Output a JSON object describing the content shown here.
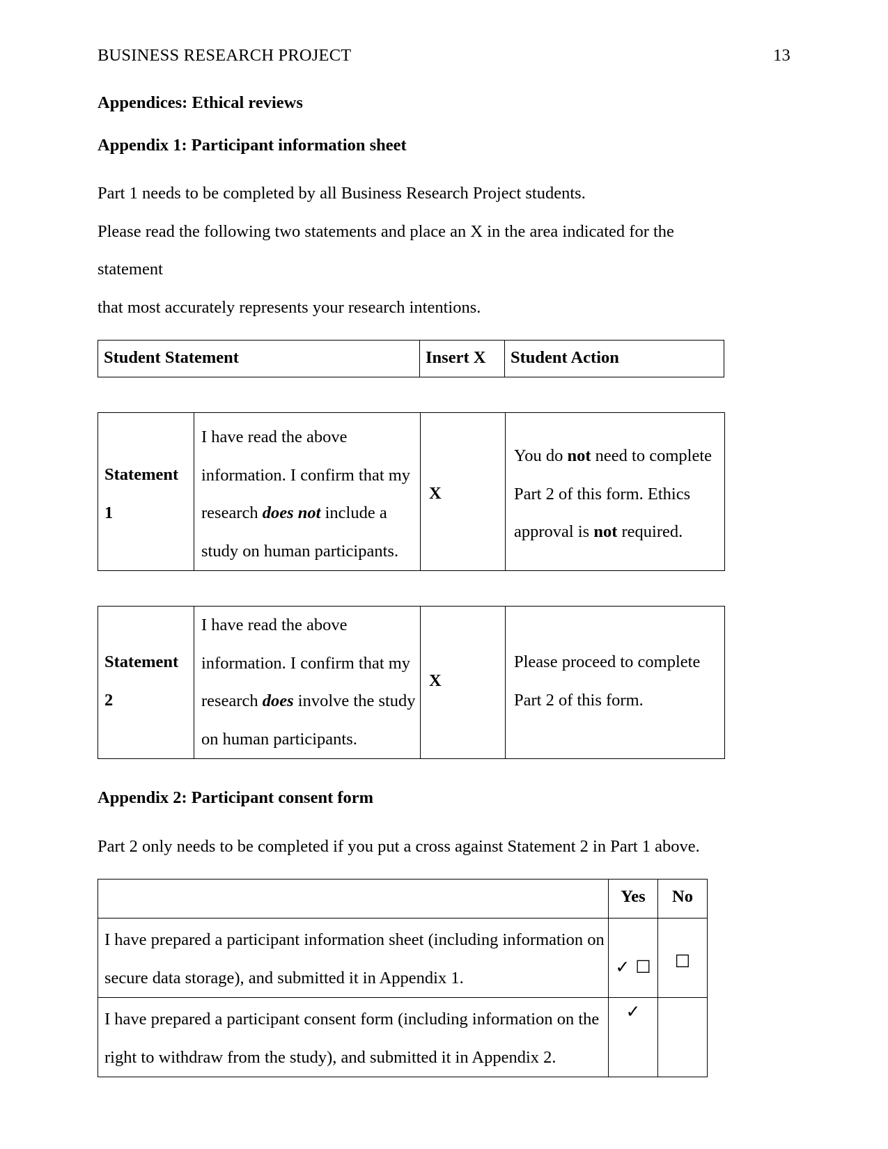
{
  "header": {
    "title": "BUSINESS RESEARCH PROJECT",
    "page_number": "13"
  },
  "headings": {
    "appendices": "Appendices: Ethical reviews",
    "appendix1": "Appendix 1: Participant information sheet",
    "appendix2": "Appendix 2: Participant consent form"
  },
  "paragraphs": {
    "part1_intro": "Part 1 needs to be completed by all Business Research Project students.",
    "instruction_line1": "Please read the following two statements and place an X in the area indicated for the statement",
    "instruction_line2": "that most accurately represents your research intentions.",
    "part2_intro": "Part 2 only needs to be completed if you put a cross against Statement 2 in Part 1 above."
  },
  "statement_table_header": {
    "col1": "Student Statement",
    "col2": "Insert X",
    "col3": "Student Action"
  },
  "statement1": {
    "label_line1": "Statement",
    "label_line2": "1",
    "text_line1": "I have read the above",
    "text_line2": "information. I confirm that my",
    "text_line3_pre": "research ",
    "text_line3_em": "does not",
    "text_line3_post": " include a",
    "text_line4": "study on human participants.",
    "insert_x": "X",
    "action_line1_pre": "You do ",
    "action_line1_bold": "not",
    "action_line1_post": " need to complete",
    "action_line2": "Part 2 of this form. Ethics",
    "action_line3_pre": "approval is ",
    "action_line3_bold": "not",
    "action_line3_post": " required."
  },
  "statement2": {
    "label_line1": "Statement",
    "label_line2": "2",
    "text_line1": "I have read the above",
    "text_line2": "information. I confirm that my",
    "text_line3_pre": "research ",
    "text_line3_em": "does",
    "text_line3_post": " involve the study",
    "text_line4": "on human participants.",
    "insert_x": "X",
    "action_line1": "Please proceed to complete",
    "action_line2": "Part 2 of this form."
  },
  "consent_table": {
    "header_blank": "",
    "header_yes": "Yes",
    "header_no": "No",
    "rows": [
      {
        "text_line1": "I have prepared a participant information sheet (including information on",
        "text_line2": "secure data storage), and submitted it in Appendix 1.",
        "yes_tick": "✓",
        "yes_box": "☐",
        "no_box": "☐"
      },
      {
        "text_line1": "I have prepared a participant consent form (including information on the",
        "text_line2": "right to withdraw from the study), and submitted it in Appendix 2.",
        "yes_tick": "✓",
        "yes_box": "",
        "no_box": ""
      }
    ]
  }
}
